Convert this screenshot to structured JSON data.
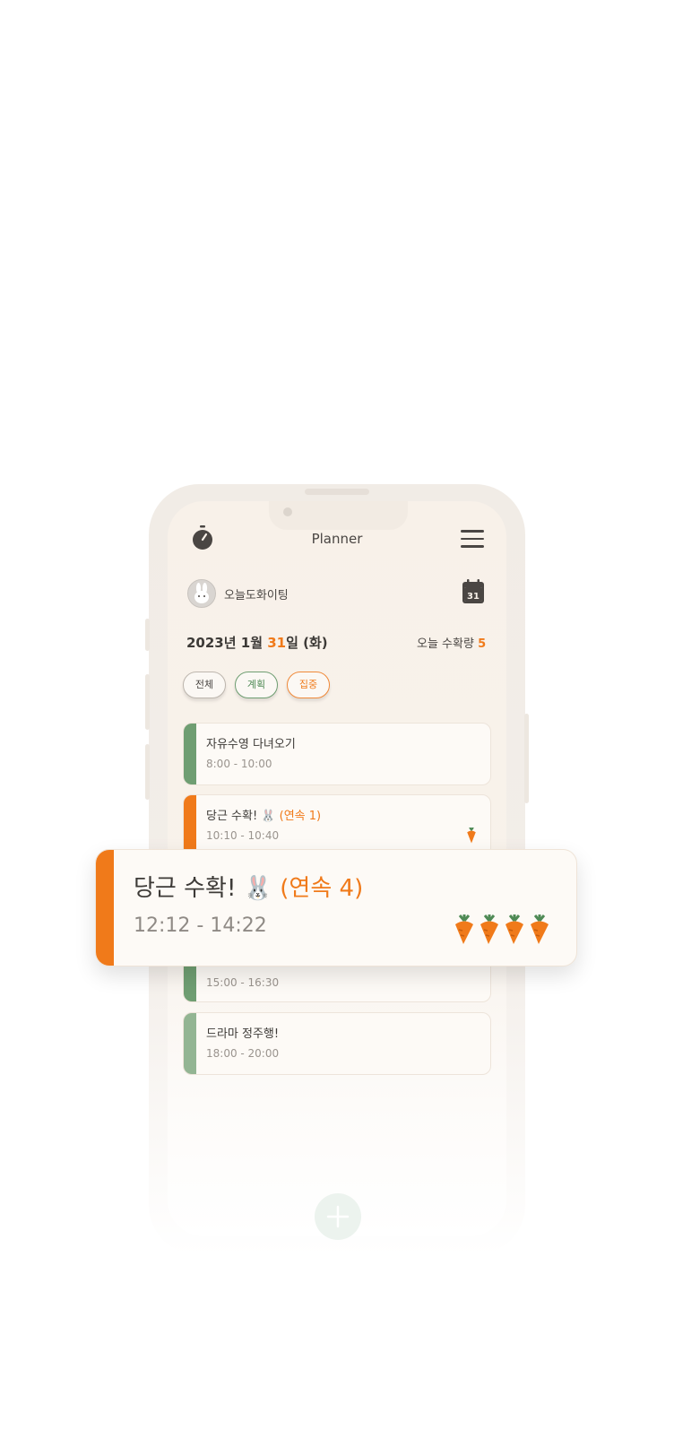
{
  "header": {
    "title": "Planner"
  },
  "profile": {
    "username": "오늘도화이팅"
  },
  "calendar_icon_day": "31",
  "date": {
    "prefix": "2023년 1월 ",
    "day": "31",
    "suffix": "일 (화)"
  },
  "harvest": {
    "label": "오늘 수확량 ",
    "count": "5"
  },
  "filters": [
    {
      "label": "전체"
    },
    {
      "label": "계획"
    },
    {
      "label": "집중"
    }
  ],
  "tasks": [
    {
      "title": "자유수영 다녀오기",
      "time": "8:00 - 10:00",
      "type": "plan"
    },
    {
      "title": "당근 수확! 🐰 ",
      "streak": "(연속 1)",
      "time": "10:10 - 10:40",
      "type": "focus",
      "carrots": 1
    },
    {
      "title": "",
      "time": "15:00 - 16:30",
      "type": "plan"
    },
    {
      "title": "드라마 정주행!",
      "time": "18:00 - 20:00",
      "type": "plan"
    }
  ],
  "highlight_task": {
    "title": "당근 수확! 🐰 ",
    "streak": "(연속 4)",
    "time": "12:12 - 14:22",
    "carrots": 4
  },
  "colors": {
    "accent": "#f07a1a",
    "plan": "#6f9e72",
    "background": "#f8f1e9"
  },
  "icons": [
    "timer-icon",
    "menu-icon",
    "rabbit-avatar-icon",
    "calendar-icon",
    "carrot-icon",
    "plus-icon"
  ]
}
